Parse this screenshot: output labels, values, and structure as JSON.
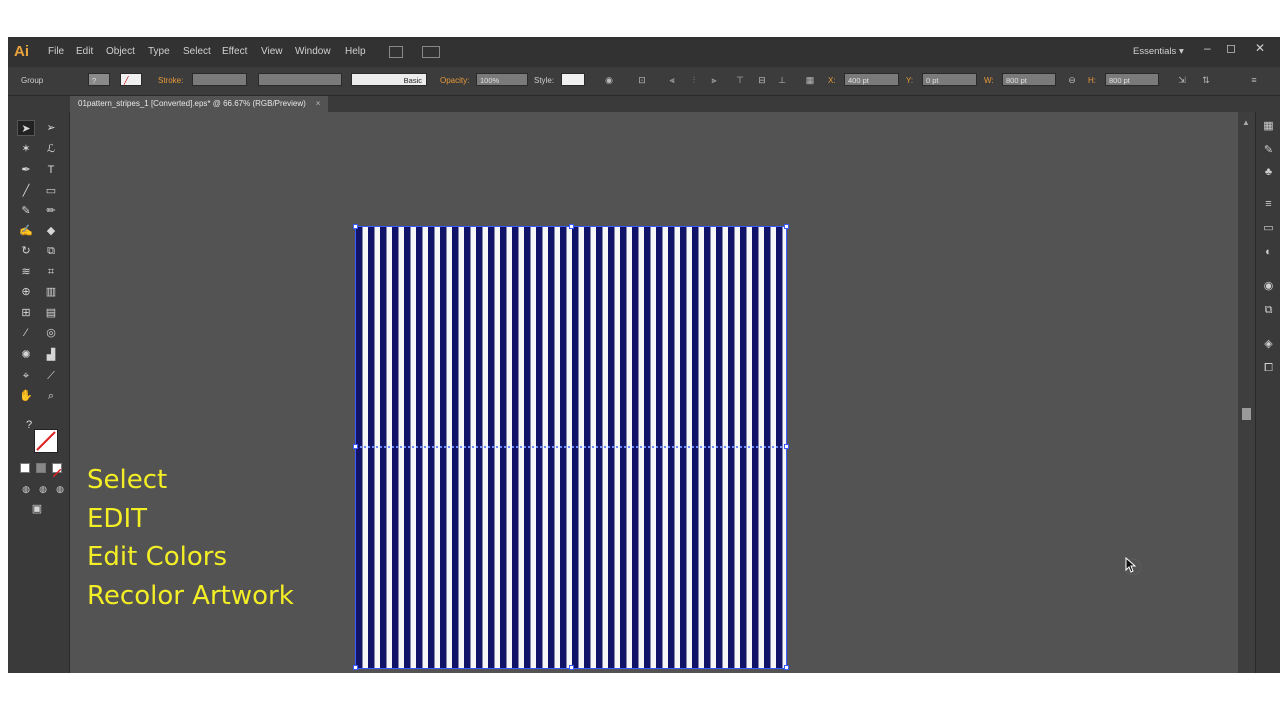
{
  "app": {
    "logo": "Ai",
    "menu": [
      "File",
      "Edit",
      "Object",
      "Type",
      "Select",
      "Effect",
      "View",
      "Window",
      "Help"
    ],
    "workspace": "Essentials",
    "window_controls": [
      "‒",
      "◻",
      "✕"
    ]
  },
  "control_bar": {
    "selection_label": "Group",
    "stroke_label": "Stroke:",
    "brush_label": "Basic",
    "opacity_label": "Opacity:",
    "opacity_value": "100%",
    "style_label": "Style:",
    "x_label": "X:",
    "x_value": "400 pt",
    "y_label": "Y:",
    "y_value": "0 pt",
    "w_label": "W:",
    "w_value": "800 pt",
    "h_label": "H:",
    "h_value": "800 pt"
  },
  "document": {
    "tab_title": "01pattern_stripes_1 [Converted].eps* @ 66.67% (RGB/Preview)",
    "tab_close": "×"
  },
  "artwork": {
    "stripe_color": "#111466",
    "background_color": "#f7f7f7",
    "selection_color": "#3c5aff"
  },
  "instructions": {
    "lines": [
      "Select",
      "EDIT",
      "Edit Colors",
      "Recolor Artwork"
    ],
    "color": "#f3ee25"
  },
  "icons": {
    "tools": [
      "selection-tool",
      "direct-selection-tool",
      "magic-wand-tool",
      "lasso-tool",
      "pen-tool",
      "type-tool",
      "line-tool",
      "rectangle-tool",
      "paintbrush-tool",
      "pencil-tool",
      "blob-brush-tool",
      "eraser-tool",
      "rotate-tool",
      "scale-tool",
      "warp-tool",
      "free-transform-tool",
      "shape-builder-tool",
      "perspective-grid-tool",
      "mesh-tool",
      "gradient-tool",
      "eyedropper-tool",
      "blend-tool",
      "symbol-sprayer-tool",
      "column-graph-tool",
      "artboard-tool",
      "slice-tool",
      "hand-tool",
      "zoom-tool"
    ],
    "panels": [
      "color-panel",
      "brushes-panel",
      "symbols-panel",
      "stroke-panel",
      "gradient-panel",
      "transparency-panel",
      "appearance-panel",
      "graphic-styles-panel",
      "layers-panel",
      "artboards-panel"
    ]
  }
}
